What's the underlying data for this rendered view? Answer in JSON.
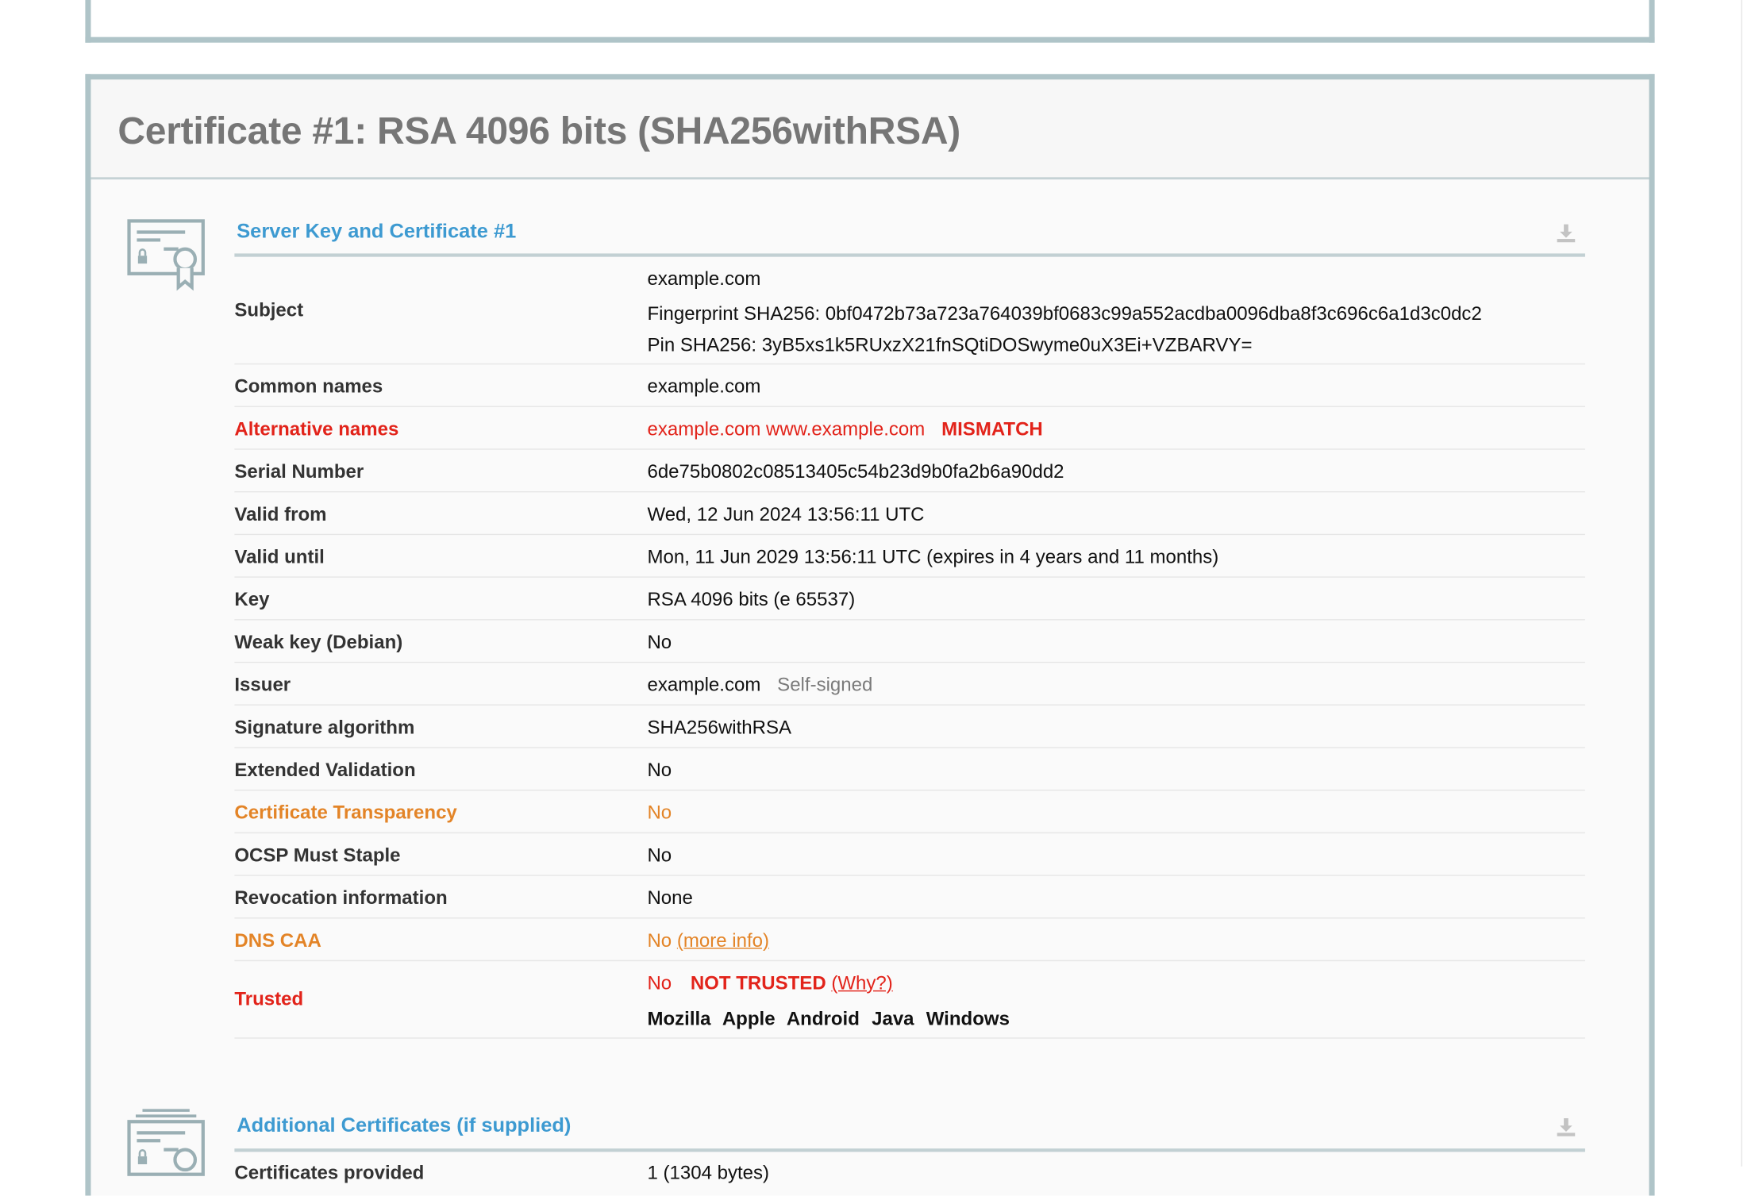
{
  "certificate": {
    "title": "Certificate #1: RSA 4096 bits (SHA256withRSA)",
    "section_title": "Server Key and Certificate #1",
    "rows": {
      "subject": {
        "label": "Subject",
        "value": "example.com",
        "fingerprint": "Fingerprint SHA256: 0bf0472b73a723a764039bf0683c99a552acdba0096dba8f3c696c6a1d3c0dc2",
        "pin": "Pin SHA256: 3yB5xs1k5RUxzX21fnSQtiDOSwyme0uX3Ei+VZBARVY="
      },
      "common_names": {
        "label": "Common names",
        "value": "example.com"
      },
      "alternative_names": {
        "label": "Alternative names",
        "value": "example.com www.example.com",
        "flag": "MISMATCH"
      },
      "serial_number": {
        "label": "Serial Number",
        "value": "6de75b0802c08513405c54b23d9b0fa2b6a90dd2"
      },
      "valid_from": {
        "label": "Valid from",
        "value": "Wed, 12 Jun 2024 13:56:11 UTC"
      },
      "valid_until": {
        "label": "Valid until",
        "value": "Mon, 11 Jun 2029 13:56:11 UTC (expires in 4 years and 11 months)"
      },
      "key": {
        "label": "Key",
        "value": "RSA 4096 bits (e 65537)"
      },
      "weak_key": {
        "label": "Weak key (Debian)",
        "value": "No"
      },
      "issuer": {
        "label": "Issuer",
        "value": "example.com",
        "note": "Self-signed"
      },
      "signature_algorithm": {
        "label": "Signature algorithm",
        "value": "SHA256withRSA"
      },
      "extended_validation": {
        "label": "Extended Validation",
        "value": "No"
      },
      "certificate_transparency": {
        "label": "Certificate Transparency",
        "value": "No"
      },
      "ocsp_must_staple": {
        "label": "OCSP Must Staple",
        "value": "No"
      },
      "revocation_information": {
        "label": "Revocation information",
        "value": "None"
      },
      "dns_caa": {
        "label": "DNS CAA",
        "value": "No",
        "link": "(more info)"
      },
      "trusted": {
        "label": "Trusted",
        "value": "No",
        "flag": "NOT TRUSTED",
        "link": "(Why?)",
        "platforms": [
          "Mozilla",
          "Apple",
          "Android",
          "Java",
          "Windows"
        ]
      }
    }
  },
  "additional": {
    "section_title": "Additional Certificates (if supplied)",
    "row": {
      "label": "Certificates provided",
      "value": "1 (1304 bytes)"
    }
  },
  "colors": {
    "heading_blue": "#3d9ad1",
    "error_red": "#e2231a",
    "warning_orange": "#e38427",
    "panel_border": "#afc4c8",
    "success_green": "#7ec45f"
  },
  "icons": {
    "certificate": "certificate-icon",
    "download": "download-icon"
  }
}
